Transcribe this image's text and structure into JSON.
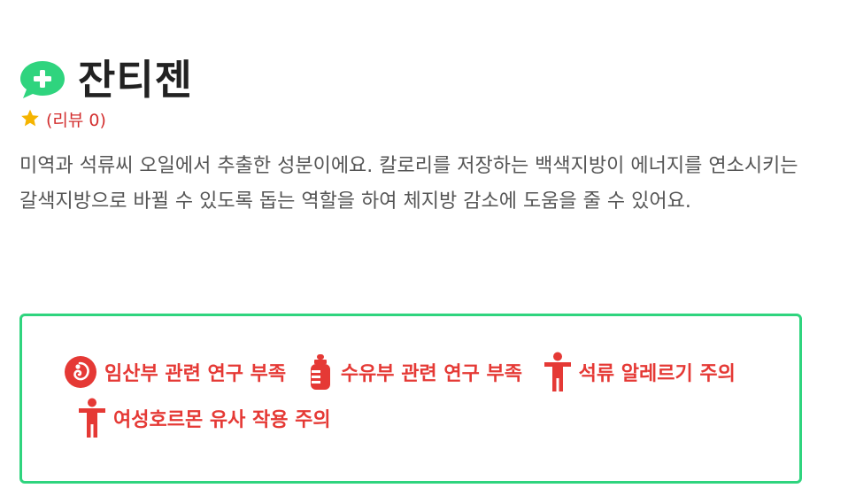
{
  "header": {
    "icon": "chat-bubble-plus-icon",
    "title": "잔티젠",
    "accent_color": "#2fd47e"
  },
  "rating": {
    "icon": "star-icon",
    "review_label": "(리뷰 0)",
    "star_color": "#f5b400"
  },
  "description": "미역과 석류씨 오일에서 추출한 성분이에요. 칼로리를 저장하는 백색지방이 에너지를 연소시키는 갈색지방으로 바뀔 수 있도록 돕는 역할을 하여 체지방 감소에 도움을 줄 수 있어요.",
  "warnings": {
    "border_color": "#2fd47e",
    "text_color": "#e53935",
    "items": [
      {
        "icon": "pregnancy-icon",
        "label": "임산부 관련 연구 부족"
      },
      {
        "icon": "baby-bottle-icon",
        "label": "수유부 관련 연구 부족"
      },
      {
        "icon": "person-icon",
        "label": "석류 알레르기 주의"
      },
      {
        "icon": "person-icon",
        "label": "여성호르몬 유사 작용 주의"
      }
    ]
  }
}
